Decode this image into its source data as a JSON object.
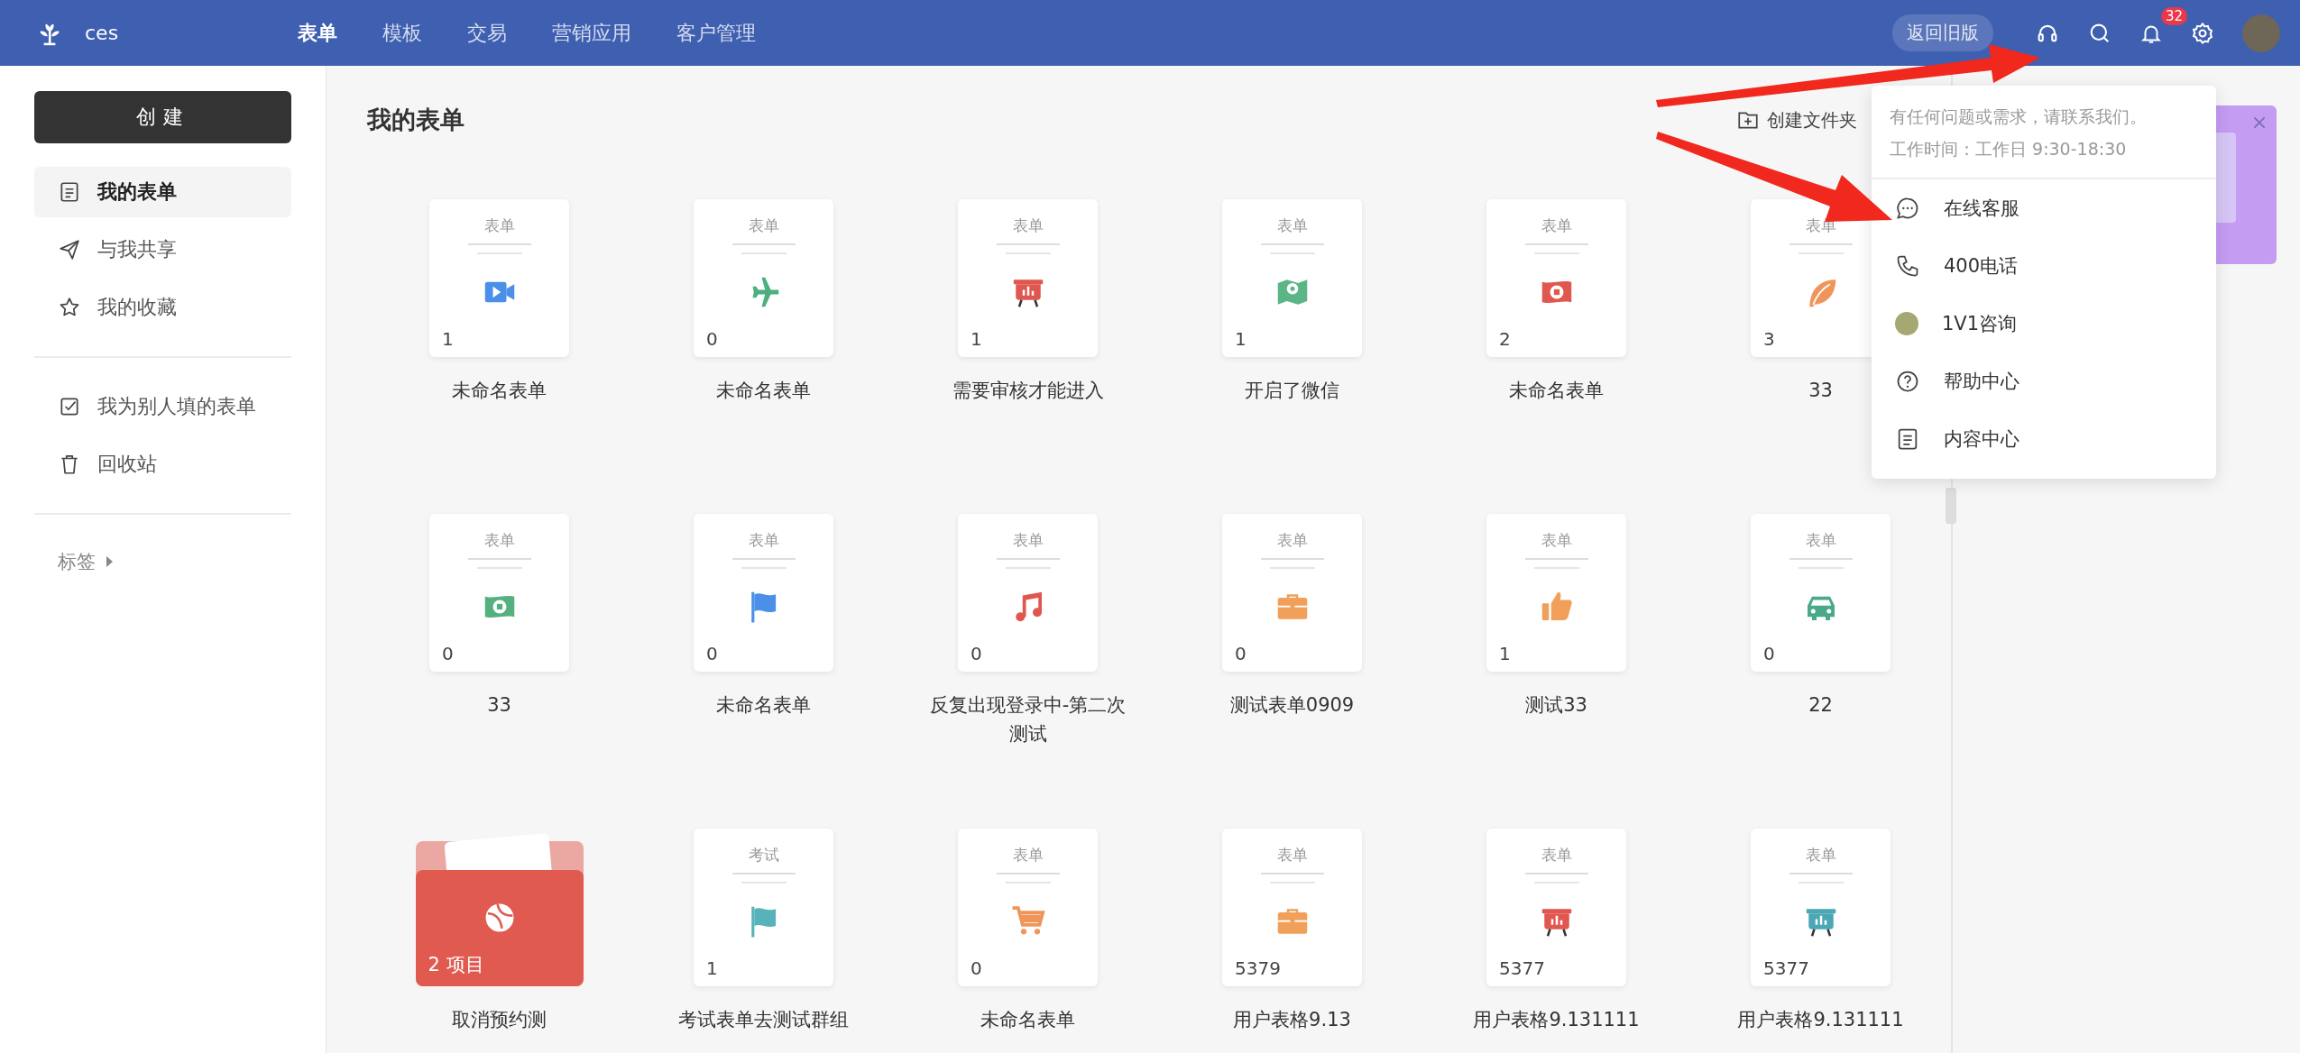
{
  "header": {
    "brand": "ces",
    "nav": [
      {
        "label": "表单",
        "selected": true
      },
      {
        "label": "模板",
        "selected": false
      },
      {
        "label": "交易",
        "selected": false
      },
      {
        "label": "营销应用",
        "selected": false
      },
      {
        "label": "客户管理",
        "selected": false
      }
    ],
    "legacy_button": "返回旧版",
    "notification_count": "32"
  },
  "sidebar": {
    "create_button": "创建",
    "items": [
      {
        "label": "我的表单",
        "selected": true
      },
      {
        "label": "与我共享",
        "selected": false
      },
      {
        "label": "我的收藏",
        "selected": false
      }
    ],
    "more_items": [
      {
        "label": "我为别人填的表单",
        "selected": false
      },
      {
        "label": "回收站",
        "selected": false
      }
    ],
    "tags_label": "标签"
  },
  "main": {
    "title": "我的表单",
    "create_folder": "创建文件夹",
    "items": [
      {
        "kind": "form",
        "tag": "表单",
        "color": "#4a8fe8",
        "count": "1",
        "title": "未命名表单"
      },
      {
        "kind": "form",
        "tag": "表单",
        "color": "#4caf7d",
        "count": "0",
        "title": "未命名表单"
      },
      {
        "kind": "form",
        "tag": "表单",
        "color": "#e0574f",
        "count": "1",
        "title": "需要审核才能进入"
      },
      {
        "kind": "form",
        "tag": "表单",
        "color": "#5cb585",
        "count": "1",
        "title": "开启了微信"
      },
      {
        "kind": "form",
        "tag": "表单",
        "color": "#e0574f",
        "count": "2",
        "title": "未命名表单"
      },
      {
        "kind": "form",
        "tag": "表单",
        "color": "#f0955a",
        "count": "3",
        "title": "33"
      },
      {
        "kind": "form",
        "tag": "表单",
        "color": "#55b07f",
        "count": "0",
        "title": "33"
      },
      {
        "kind": "form",
        "tag": "表单",
        "color": "#4a8fe8",
        "count": "0",
        "title": "未命名表单"
      },
      {
        "kind": "form",
        "tag": "表单",
        "color": "#e0574f",
        "count": "0",
        "title": "反复出现登录中-第二次测试"
      },
      {
        "kind": "form",
        "tag": "表单",
        "color": "#f0a05a",
        "count": "0",
        "title": "测试表单0909"
      },
      {
        "kind": "form",
        "tag": "表单",
        "color": "#f0a05a",
        "count": "1",
        "title": "测试33"
      },
      {
        "kind": "form",
        "tag": "表单",
        "color": "#4aa987",
        "count": "0",
        "title": "22"
      },
      {
        "kind": "folder",
        "color": "#e05a50",
        "count": "2 项目",
        "title": "取消预约测"
      },
      {
        "kind": "form",
        "tag": "考试",
        "color": "#58b2b9",
        "count": "1",
        "title": "考试表单去测试群组"
      },
      {
        "kind": "form",
        "tag": "表单",
        "color": "#f0955a",
        "count": "0",
        "title": "未命名表单"
      },
      {
        "kind": "form",
        "tag": "表单",
        "color": "#f0a05a",
        "count": "5379",
        "title": "用户表格9.13"
      },
      {
        "kind": "form",
        "tag": "表单",
        "color": "#e0574f",
        "count": "5377",
        "title": "用户表格9.131111"
      },
      {
        "kind": "form",
        "tag": "表单",
        "color": "#4aa8b5",
        "count": "5377",
        "title": "用户表格9.131111"
      }
    ]
  },
  "help_menu": {
    "message": "有任何问题或需求，请联系我们。",
    "hours": "工作时间：工作日 9:30-18:30",
    "items": [
      "在线客服",
      "400电话",
      "1V1咨询",
      "帮助中心",
      "内容中心"
    ]
  }
}
